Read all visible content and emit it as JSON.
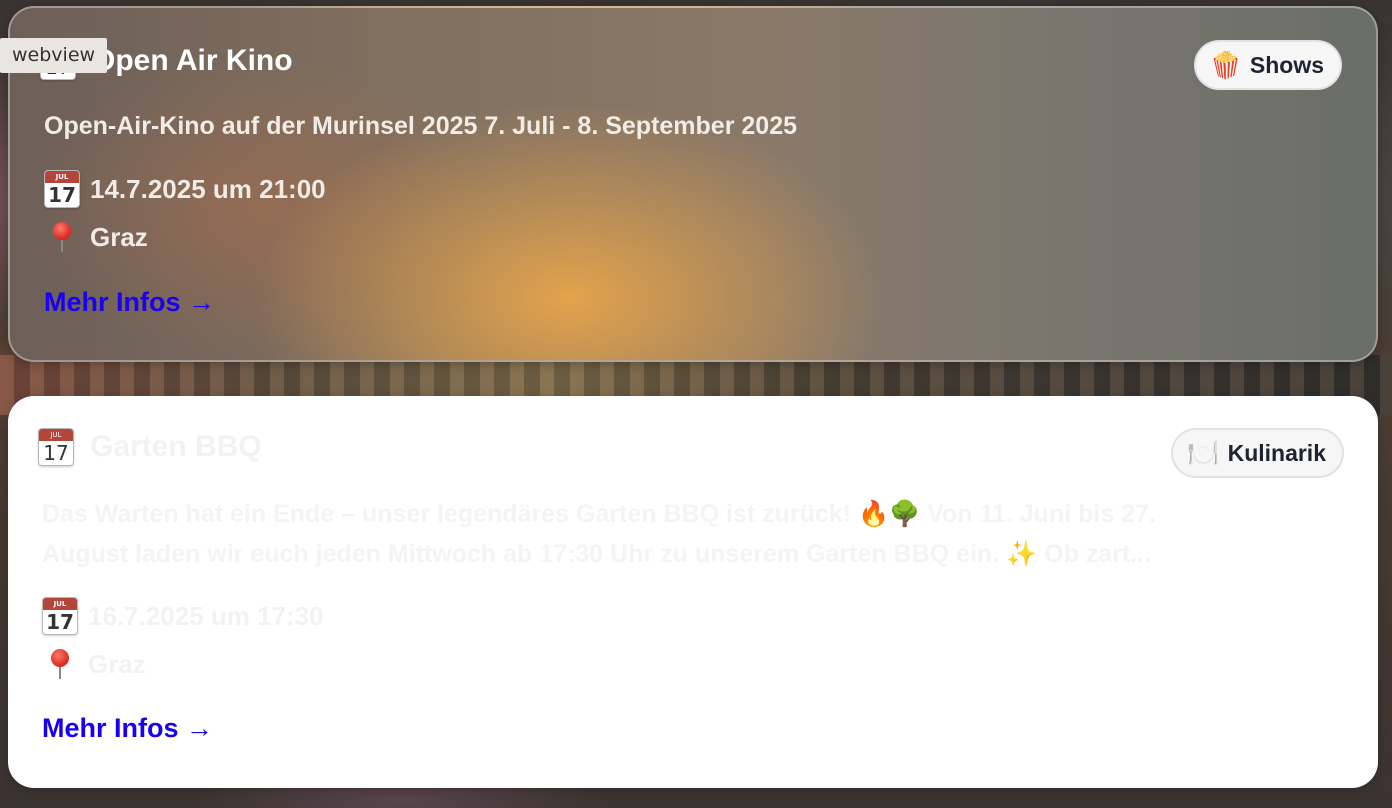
{
  "debug_tag": "webview",
  "colors": {
    "link": "#1a00f0",
    "badge_text": "#1d2330",
    "glass_accent": "#e8a54b"
  },
  "events": [
    {
      "title": "Open Air Kino",
      "title_icon": "calendar-icon",
      "category": {
        "icon": "🍿",
        "label": "Shows"
      },
      "description": "Open-Air-Kino auf der Murinsel 2025 7. Juli - 8. September 2025",
      "date": "14.7.2025 um 21:00",
      "location": "Graz",
      "link_label": "Mehr Infos →"
    },
    {
      "title": "Garten BBQ",
      "title_icon": "calendar-icon",
      "category": {
        "icon": "🍽️",
        "label": "Kulinarik"
      },
      "description_line1": "Das Warten hat ein Ende – unser legendäres Garten BBQ ist zurück! 🔥🌳 Von 11. Juni bis 27.",
      "description_line2": "August laden wir euch jeden Mittwoch ab 17:30 Uhr zu unserem Garten BBQ ein. ✨ Ob zart...",
      "date": "16.7.2025 um 17:30",
      "location": "Graz",
      "link_label": "Mehr Infos →"
    }
  ],
  "calendar_icon": {
    "month": "JUL",
    "day": "17"
  }
}
